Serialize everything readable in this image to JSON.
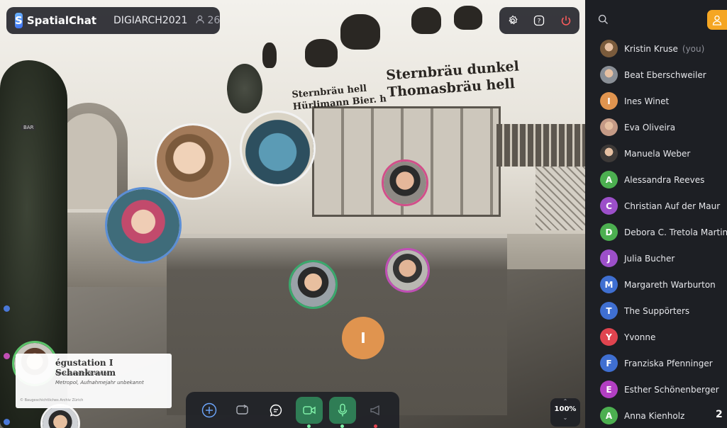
{
  "app": {
    "name": "SpatialChat",
    "logo_letter": "S"
  },
  "space": {
    "name": "DIGIARCH2021",
    "participant_count": "26"
  },
  "room_signs": {
    "brand_dunkel": "Sternbräu dunkel",
    "brand_hell": "Thomasbräu hell",
    "small_1": "Sternbräu hell",
    "small_2": "Hürlimann Bier. h",
    "bar": "BAR"
  },
  "info_card": {
    "title": "égustation I Schankraum",
    "line1": "opol, Année inconnue",
    "line2": "Metropol, Aufnahmejahr unbekannt",
    "credit": "© Baugeschichtliches Archiv Zürich"
  },
  "stage_avatars": [
    {
      "letter": "I",
      "color": "#e0944f"
    }
  ],
  "toolbar": {
    "buttons": [
      {
        "name": "add",
        "active": false
      },
      {
        "name": "share-screen",
        "active": false
      },
      {
        "name": "chat",
        "active": false
      },
      {
        "name": "camera",
        "active": true
      },
      {
        "name": "microphone",
        "active": true
      },
      {
        "name": "megaphone",
        "active": false
      }
    ]
  },
  "zoom": {
    "value": "100%"
  },
  "sidebar": {
    "you_label": "(you)",
    "participants": [
      {
        "name": "Kristin Kruse",
        "you": true,
        "type": "photo",
        "color": "#7a5b3c"
      },
      {
        "name": "Beat Eberschweiler",
        "type": "photo",
        "color": "#8a8f96"
      },
      {
        "name": "Ines Winet",
        "type": "letter",
        "letter": "I",
        "color": "#e0944f"
      },
      {
        "name": "Eva Oliveira",
        "type": "photo",
        "color": "#c49a86"
      },
      {
        "name": "Manuela Weber",
        "type": "photo",
        "color": "#3e3a38"
      },
      {
        "name": "Alessandra Reeves",
        "type": "letter",
        "letter": "A",
        "color": "#4caf50"
      },
      {
        "name": "Christian Auf der Maur",
        "type": "letter",
        "letter": "C",
        "color": "#9c4fc9"
      },
      {
        "name": "Debora C. Tretola Martinez",
        "type": "letter",
        "letter": "D",
        "color": "#4caf50"
      },
      {
        "name": "Julia Bucher",
        "type": "letter",
        "letter": "J",
        "color": "#9c4fc9"
      },
      {
        "name": "Margareth Warburton",
        "type": "letter",
        "letter": "M",
        "color": "#3f6fd1"
      },
      {
        "name": "The Suppörters",
        "type": "letter",
        "letter": "T",
        "color": "#3f6fd1"
      },
      {
        "name": "Yvonne",
        "type": "letter",
        "letter": "Y",
        "color": "#e0444f"
      },
      {
        "name": "Franziska Pfenninger",
        "type": "letter",
        "letter": "F",
        "color": "#3f6fd1"
      },
      {
        "name": "Esther Schönenberger",
        "type": "letter",
        "letter": "E",
        "color": "#b23fc3"
      },
      {
        "name": "Anna Kienholz",
        "type": "letter",
        "letter": "A",
        "color": "#4caf50"
      }
    ],
    "page_badge": "2"
  },
  "colors": {
    "accent_orange": "#f5a623",
    "active_green": "#2f7d55",
    "power_red": "#ff5d5d"
  }
}
